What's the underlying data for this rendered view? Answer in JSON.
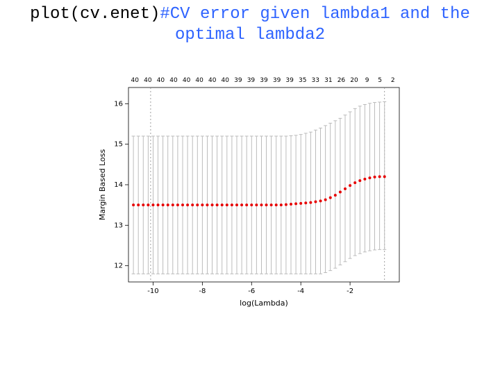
{
  "title": {
    "code": "plot(cv.enet)",
    "comment": "#CV error given lambda1 and the optimal lambda2"
  },
  "chart_data": {
    "type": "line",
    "xlabel": "log(Lambda)",
    "ylabel": "Margin Based Loss",
    "xlim": [
      -11,
      0
    ],
    "ylim": [
      11.6,
      16.4
    ],
    "xticks": [
      -10,
      -8,
      -6,
      -4,
      -2
    ],
    "yticks": [
      12,
      13,
      14,
      15,
      16
    ],
    "top_counts": [
      40,
      40,
      40,
      40,
      40,
      40,
      40,
      40,
      39,
      39,
      39,
      39,
      39,
      35,
      33,
      31,
      26,
      20,
      9,
      5,
      2
    ],
    "vlines": {
      "x1": -10.1,
      "x2": -0.6
    },
    "series": [
      {
        "name": "cv-mean",
        "x": [
          -10.8,
          -10.6,
          -10.4,
          -10.2,
          -10.0,
          -9.8,
          -9.6,
          -9.4,
          -9.2,
          -9.0,
          -8.8,
          -8.6,
          -8.4,
          -8.2,
          -8.0,
          -7.8,
          -7.6,
          -7.4,
          -7.2,
          -7.0,
          -6.8,
          -6.6,
          -6.4,
          -6.2,
          -6.0,
          -5.8,
          -5.6,
          -5.4,
          -5.2,
          -5.0,
          -4.8,
          -4.6,
          -4.4,
          -4.2,
          -4.0,
          -3.8,
          -3.6,
          -3.4,
          -3.2,
          -3.0,
          -2.8,
          -2.6,
          -2.4,
          -2.2,
          -2.0,
          -1.8,
          -1.6,
          -1.4,
          -1.2,
          -1.0,
          -0.8,
          -0.6
        ],
        "y": [
          13.5,
          13.5,
          13.5,
          13.5,
          13.5,
          13.5,
          13.5,
          13.5,
          13.5,
          13.5,
          13.5,
          13.5,
          13.5,
          13.5,
          13.5,
          13.5,
          13.5,
          13.5,
          13.5,
          13.5,
          13.5,
          13.5,
          13.5,
          13.5,
          13.5,
          13.5,
          13.5,
          13.5,
          13.5,
          13.5,
          13.5,
          13.51,
          13.52,
          13.53,
          13.54,
          13.55,
          13.56,
          13.58,
          13.6,
          13.63,
          13.68,
          13.74,
          13.82,
          13.9,
          13.98,
          14.05,
          14.1,
          14.14,
          14.17,
          14.19,
          14.2,
          14.2
        ],
        "err_lo": [
          11.8,
          11.8,
          11.8,
          11.8,
          11.8,
          11.8,
          11.8,
          11.8,
          11.8,
          11.8,
          11.8,
          11.8,
          11.8,
          11.8,
          11.8,
          11.8,
          11.8,
          11.8,
          11.8,
          11.8,
          11.8,
          11.8,
          11.8,
          11.8,
          11.8,
          11.8,
          11.8,
          11.8,
          11.8,
          11.8,
          11.8,
          11.8,
          11.8,
          11.8,
          11.8,
          11.8,
          11.8,
          11.8,
          11.8,
          11.83,
          11.88,
          11.94,
          12.02,
          12.1,
          12.18,
          12.25,
          12.3,
          12.34,
          12.37,
          12.39,
          12.4,
          12.4
        ],
        "err_hi": [
          15.2,
          15.2,
          15.2,
          15.2,
          15.2,
          15.2,
          15.2,
          15.2,
          15.2,
          15.2,
          15.2,
          15.2,
          15.2,
          15.2,
          15.2,
          15.2,
          15.2,
          15.2,
          15.2,
          15.2,
          15.2,
          15.2,
          15.2,
          15.2,
          15.2,
          15.2,
          15.2,
          15.2,
          15.2,
          15.2,
          15.2,
          15.2,
          15.21,
          15.22,
          15.24,
          15.27,
          15.3,
          15.35,
          15.4,
          15.46,
          15.52,
          15.58,
          15.64,
          15.72,
          15.8,
          15.88,
          15.94,
          15.98,
          16.01,
          16.03,
          16.04,
          16.05
        ]
      }
    ]
  }
}
